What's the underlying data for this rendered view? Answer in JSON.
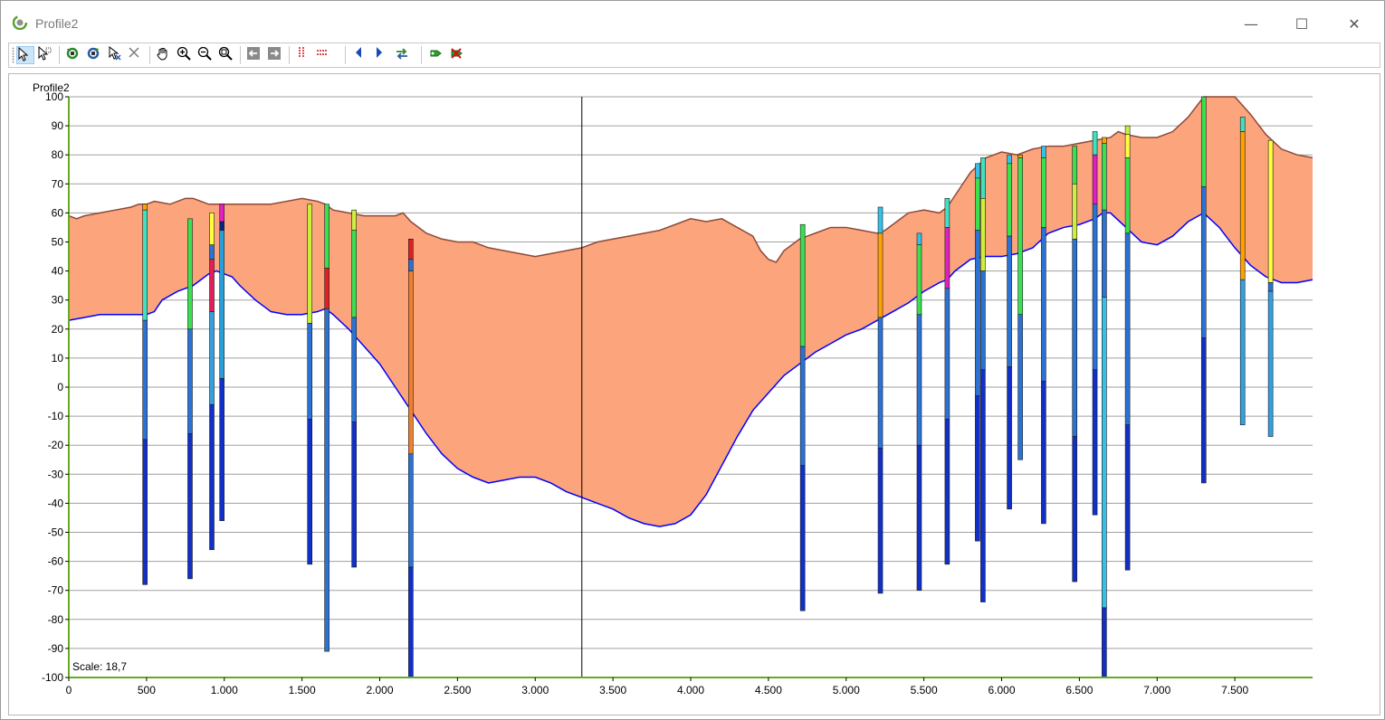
{
  "window": {
    "title": "Profile2",
    "minimize_glyph": "—",
    "maximize_glyph": "☐",
    "close_glyph": "✕"
  },
  "toolbar": {
    "buttons": [
      {
        "name": "select-arrow-icon"
      },
      {
        "name": "select-multiple-icon"
      },
      {
        "name": "refresh-green-icon"
      },
      {
        "name": "refresh-blue-icon"
      },
      {
        "name": "pointer-cross-icon"
      },
      {
        "name": "delete-x-icon"
      },
      {
        "name": "pan-hand-icon"
      },
      {
        "name": "zoom-in-icon"
      },
      {
        "name": "zoom-out-icon"
      },
      {
        "name": "zoom-extent-icon"
      },
      {
        "name": "arrow-left-box-icon"
      },
      {
        "name": "arrow-right-box-icon"
      },
      {
        "name": "vertical-lines-icon"
      },
      {
        "name": "horizontal-lines-icon"
      },
      {
        "name": "previous-icon"
      },
      {
        "name": "next-icon"
      },
      {
        "name": "swap-green-icon"
      },
      {
        "name": "add-green-icon"
      },
      {
        "name": "remove-red-icon"
      }
    ]
  },
  "chart": {
    "title": "Profile2",
    "scale_text": "Scale: 18,7",
    "colors": {
      "fill": "#fca47c",
      "top_line": "#8b4a3a",
      "bottom_line": "#0000ff",
      "grid": "#a0a0a0",
      "axis": "#66aa22"
    }
  },
  "chart_data": {
    "type": "area",
    "title": "Profile2",
    "xlim": [
      0,
      8000
    ],
    "ylim": [
      -100,
      100
    ],
    "x_ticks": [
      "0",
      "500",
      "1.000",
      "1.500",
      "2.000",
      "2.500",
      "3.000",
      "3.500",
      "4.000",
      "4.500",
      "5.000",
      "5.500",
      "6.000",
      "6.500",
      "7.000",
      "7.500"
    ],
    "x_tick_values": [
      0,
      500,
      1000,
      1500,
      2000,
      2500,
      3000,
      3500,
      4000,
      4500,
      5000,
      5500,
      6000,
      6500,
      7000,
      7500
    ],
    "y_ticks": [
      "100",
      "90",
      "80",
      "70",
      "60",
      "50",
      "40",
      "30",
      "20",
      "10",
      "0",
      "-10",
      "-20",
      "-30",
      "-40",
      "-50",
      "-60",
      "-70",
      "-80",
      "-90",
      "-100"
    ],
    "y_tick_values": [
      100,
      90,
      80,
      70,
      60,
      50,
      40,
      30,
      20,
      10,
      0,
      -10,
      -20,
      -30,
      -40,
      -50,
      -60,
      -70,
      -80,
      -90,
      -100
    ],
    "cursor_x": 3300,
    "series": [
      {
        "name": "surface",
        "x": [
          0,
          50,
          100,
          200,
          300,
          400,
          450,
          500,
          550,
          650,
          750,
          800,
          850,
          900,
          1000,
          1100,
          1200,
          1300,
          1400,
          1500,
          1600,
          1650,
          1700,
          1800,
          1900,
          2000,
          2100,
          2150,
          2200,
          2300,
          2400,
          2500,
          2600,
          2700,
          2800,
          2900,
          3000,
          3100,
          3200,
          3300,
          3400,
          3500,
          3600,
          3700,
          3800,
          3900,
          4000,
          4100,
          4200,
          4300,
          4400,
          4450,
          4500,
          4550,
          4600,
          4700,
          4800,
          4900,
          5000,
          5100,
          5200,
          5250,
          5300,
          5400,
          5500,
          5600,
          5650,
          5700,
          5800,
          5900,
          6000,
          6100,
          6200,
          6300,
          6400,
          6500,
          6600,
          6700,
          6750,
          6800,
          6900,
          7000,
          7100,
          7200,
          7300,
          7400,
          7500,
          7600,
          7700,
          7800,
          7900,
          8000
        ],
        "y": [
          59,
          58,
          59,
          60,
          61,
          62,
          63,
          63,
          64,
          63,
          65,
          65,
          64,
          63,
          63,
          63,
          63,
          63,
          64,
          65,
          64,
          63,
          61,
          60,
          59,
          59,
          59,
          60,
          57,
          53,
          51,
          50,
          50,
          48,
          47,
          46,
          45,
          46,
          47,
          48,
          50,
          51,
          52,
          53,
          54,
          56,
          58,
          57,
          58,
          55,
          52,
          47,
          44,
          43,
          47,
          51,
          53,
          55,
          55,
          54,
          53,
          54,
          56,
          60,
          61,
          60,
          62,
          66,
          74,
          79,
          81,
          80,
          82,
          83,
          83,
          84,
          85,
          86,
          88,
          87,
          86,
          86,
          88,
          93,
          100,
          101,
          100,
          94,
          87,
          82,
          80,
          79
        ]
      },
      {
        "name": "base",
        "x": [
          0,
          100,
          200,
          300,
          400,
          450,
          500,
          550,
          600,
          700,
          800,
          850,
          900,
          950,
          1000,
          1050,
          1100,
          1200,
          1300,
          1400,
          1500,
          1600,
          1650,
          1700,
          1800,
          1900,
          2000,
          2100,
          2200,
          2300,
          2400,
          2500,
          2600,
          2700,
          2800,
          2900,
          3000,
          3100,
          3200,
          3300,
          3400,
          3500,
          3600,
          3700,
          3800,
          3900,
          4000,
          4100,
          4200,
          4300,
          4400,
          4500,
          4600,
          4700,
          4800,
          4900,
          5000,
          5100,
          5200,
          5300,
          5400,
          5500,
          5600,
          5650,
          5700,
          5800,
          5900,
          6000,
          6100,
          6200,
          6300,
          6400,
          6500,
          6600,
          6650,
          6700,
          6800,
          6900,
          7000,
          7100,
          7200,
          7300,
          7400,
          7500,
          7600,
          7700,
          7800,
          7900,
          8000
        ],
        "y": [
          23,
          24,
          25,
          25,
          25,
          25,
          25,
          26,
          30,
          33,
          35,
          37,
          39,
          40,
          39,
          38,
          35,
          30,
          26,
          25,
          25,
          26,
          27,
          25,
          20,
          14,
          8,
          0,
          -8,
          -16,
          -23,
          -28,
          -31,
          -33,
          -32,
          -31,
          -31,
          -33,
          -36,
          -38,
          -40,
          -42,
          -45,
          -47,
          -48,
          -47,
          -44,
          -37,
          -27,
          -17,
          -8,
          -2,
          4,
          8,
          12,
          15,
          18,
          20,
          23,
          26,
          29,
          33,
          36,
          37,
          40,
          44,
          45,
          45,
          46,
          48,
          53,
          55,
          56,
          58,
          60,
          60,
          55,
          50,
          49,
          52,
          57,
          60,
          55,
          48,
          42,
          38,
          36,
          36,
          37
        ]
      }
    ],
    "boreholes": [
      {
        "x": 490,
        "segments": [
          [
            61,
            63,
            "#ffa200"
          ],
          [
            23,
            61,
            "#40e0c0"
          ],
          [
            -18,
            23,
            "#2a72d4"
          ],
          [
            -68,
            -18,
            "#1030c8"
          ]
        ]
      },
      {
        "x": 780,
        "segments": [
          [
            20,
            58,
            "#39e050"
          ],
          [
            -16,
            20,
            "#2a72d4"
          ],
          [
            -66,
            -16,
            "#1030c8"
          ]
        ]
      },
      {
        "x": 920,
        "segments": [
          [
            49,
            60,
            "#ffff40"
          ],
          [
            44,
            49,
            "#2a72d4"
          ],
          [
            26,
            44,
            "#e0205a"
          ],
          [
            -6,
            26,
            "#35a0e0"
          ],
          [
            -56,
            -6,
            "#1030c8"
          ]
        ]
      },
      {
        "x": 985,
        "segments": [
          [
            57,
            63,
            "#e020c0"
          ],
          [
            54,
            57,
            "#102080"
          ],
          [
            3,
            54,
            "#2a9ed8"
          ],
          [
            -46,
            3,
            "#1030c8"
          ]
        ]
      },
      {
        "x": 1550,
        "segments": [
          [
            22,
            63,
            "#ccf040"
          ],
          [
            -11,
            22,
            "#2a72d4"
          ],
          [
            -61,
            -11,
            "#1030c8"
          ]
        ]
      },
      {
        "x": 1660,
        "segments": [
          [
            41,
            63,
            "#39e050"
          ],
          [
            27,
            41,
            "#e02020"
          ],
          [
            -91,
            27,
            "#2a72d4"
          ]
        ]
      },
      {
        "x": 1835,
        "segments": [
          [
            54,
            61,
            "#ccf040"
          ],
          [
            24,
            54,
            "#39e050"
          ],
          [
            -12,
            24,
            "#2a72d4"
          ],
          [
            -62,
            -12,
            "#1030c8"
          ]
        ]
      },
      {
        "x": 2200,
        "segments": [
          [
            44,
            51,
            "#e02020"
          ],
          [
            40,
            44,
            "#2a72d4"
          ],
          [
            -23,
            40,
            "#ee8030"
          ],
          [
            -62,
            -23,
            "#2a72d4"
          ],
          [
            -100,
            -62,
            "#1030c8"
          ]
        ]
      },
      {
        "x": 4720,
        "segments": [
          [
            14,
            56,
            "#39e050"
          ],
          [
            -27,
            14,
            "#2a72d4"
          ],
          [
            -77,
            -27,
            "#1030c8"
          ]
        ]
      },
      {
        "x": 5220,
        "segments": [
          [
            53,
            62,
            "#35c0e8"
          ],
          [
            24,
            53,
            "#ffa200"
          ],
          [
            -21,
            24,
            "#2a72d4"
          ],
          [
            -71,
            -21,
            "#1030c8"
          ]
        ]
      },
      {
        "x": 5470,
        "segments": [
          [
            49,
            53,
            "#35c0e8"
          ],
          [
            25,
            49,
            "#39e050"
          ],
          [
            -20,
            25,
            "#2a72d4"
          ],
          [
            -70,
            -20,
            "#1030c8"
          ]
        ]
      },
      {
        "x": 5650,
        "segments": [
          [
            55,
            65,
            "#40e0c0"
          ],
          [
            34,
            55,
            "#e020c0"
          ],
          [
            -11,
            34,
            "#2a72d4"
          ],
          [
            -61,
            -11,
            "#1030c8"
          ]
        ]
      },
      {
        "x": 5845,
        "segments": [
          [
            72,
            77,
            "#35c0e8"
          ],
          [
            54,
            72,
            "#39e050"
          ],
          [
            -3,
            54,
            "#2a72d4"
          ],
          [
            -53,
            -3,
            "#1030c8"
          ]
        ]
      },
      {
        "x": 5880,
        "segments": [
          [
            65,
            79,
            "#40e0c0"
          ],
          [
            40,
            65,
            "#ccf040"
          ],
          [
            6,
            40,
            "#2a72d4"
          ],
          [
            -74,
            6,
            "#1030c8"
          ]
        ]
      },
      {
        "x": 6050,
        "segments": [
          [
            77,
            80,
            "#35c0e8"
          ],
          [
            52,
            77,
            "#39e050"
          ],
          [
            7,
            52,
            "#2a72d4"
          ],
          [
            -42,
            7,
            "#1030c8"
          ]
        ]
      },
      {
        "x": 6120,
        "segments": [
          [
            79,
            80,
            "#ffa200"
          ],
          [
            25,
            79,
            "#39e050"
          ],
          [
            -25,
            25,
            "#2a72d4"
          ]
        ]
      },
      {
        "x": 6270,
        "segments": [
          [
            79,
            83,
            "#35c0e8"
          ],
          [
            55,
            79,
            "#39e050"
          ],
          [
            2,
            55,
            "#2a72d4"
          ],
          [
            -47,
            2,
            "#1030c8"
          ]
        ]
      },
      {
        "x": 6470,
        "segments": [
          [
            70,
            83,
            "#39e050"
          ],
          [
            51,
            70,
            "#ccf040"
          ],
          [
            -17,
            51,
            "#2a72d4"
          ],
          [
            -67,
            -17,
            "#1030c8"
          ]
        ]
      },
      {
        "x": 6600,
        "segments": [
          [
            80,
            88,
            "#40e0c0"
          ],
          [
            63,
            80,
            "#e020c0"
          ],
          [
            6,
            63,
            "#2a72d4"
          ],
          [
            -44,
            6,
            "#1030c8"
          ]
        ]
      },
      {
        "x": 6660,
        "segments": [
          [
            84,
            86,
            "#ffa200"
          ],
          [
            61,
            84,
            "#39e050"
          ],
          [
            31,
            61,
            "#2a72d4"
          ],
          [
            -76,
            31,
            "#35c0e8"
          ],
          [
            -100,
            -76,
            "#1030c8"
          ]
        ]
      },
      {
        "x": 6810,
        "segments": [
          [
            87,
            90,
            "#ccf040"
          ],
          [
            79,
            87,
            "#ffff40"
          ],
          [
            53,
            79,
            "#39e050"
          ],
          [
            -13,
            53,
            "#2a72d4"
          ],
          [
            -63,
            -13,
            "#1030c8"
          ]
        ]
      },
      {
        "x": 7300,
        "segments": [
          [
            69,
            101,
            "#39e050"
          ],
          [
            17,
            69,
            "#2a72d4"
          ],
          [
            -33,
            17,
            "#1030c8"
          ]
        ]
      },
      {
        "x": 7550,
        "segments": [
          [
            88,
            93,
            "#40e0c0"
          ],
          [
            37,
            88,
            "#ffa200"
          ],
          [
            -13,
            37,
            "#35a0e0"
          ]
        ]
      },
      {
        "x": 7730,
        "segments": [
          [
            36,
            85,
            "#ffff40"
          ],
          [
            33,
            36,
            "#2a72d4"
          ],
          [
            -17,
            33,
            "#35a0e0"
          ]
        ]
      }
    ]
  }
}
